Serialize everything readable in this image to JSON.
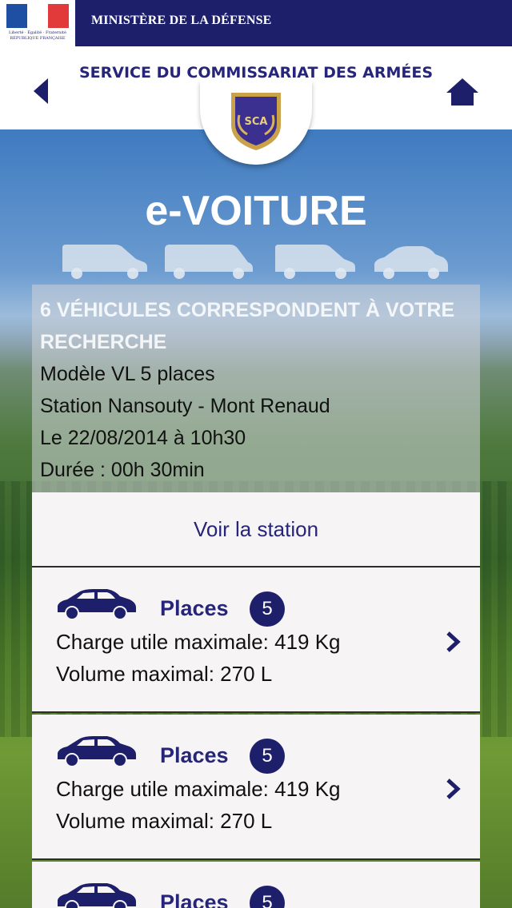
{
  "ministry": {
    "title": "MINISTÈRE DE LA DÉFENSE",
    "motto": "Liberté · Égalité · Fraternité",
    "country": "RÉPUBLIQUE FRANÇAISE"
  },
  "header": {
    "service_title": "SERVICE DU COMMISSARIAT DES ARMÉES",
    "emblem_text": "SCA",
    "back_icon": "chevron-left-icon",
    "home_icon": "home-icon"
  },
  "app_title": "e-VOITURE",
  "vehicle_icons": [
    "van-icon",
    "minibus-icon",
    "van-icon",
    "car-icon"
  ],
  "summary": {
    "heading": "6 VÉHICULES CORRESPONDENT À VOTRE RECHERCHE",
    "lines": [
      "Modèle VL 5 places",
      "Station Nansouty - Mont Renaud",
      "Le 22/08/2014 à 10h30",
      "Durée : 00h 30min"
    ]
  },
  "station_button": "Voir la station",
  "results": [
    {
      "places_label": "Places",
      "places": "5",
      "charge": "Charge utile maximale: 419 Kg",
      "volume": "Volume maximal: 270 L"
    },
    {
      "places_label": "Places",
      "places": "5",
      "charge": "Charge utile maximale: 419 Kg",
      "volume": "Volume maximal: 270 L"
    },
    {
      "places_label": "Places",
      "places": "5",
      "charge": "",
      "volume": ""
    }
  ],
  "colors": {
    "navy": "#1d1f6b",
    "title_blue": "#26257a",
    "card_bg": "#f6f4f5"
  }
}
